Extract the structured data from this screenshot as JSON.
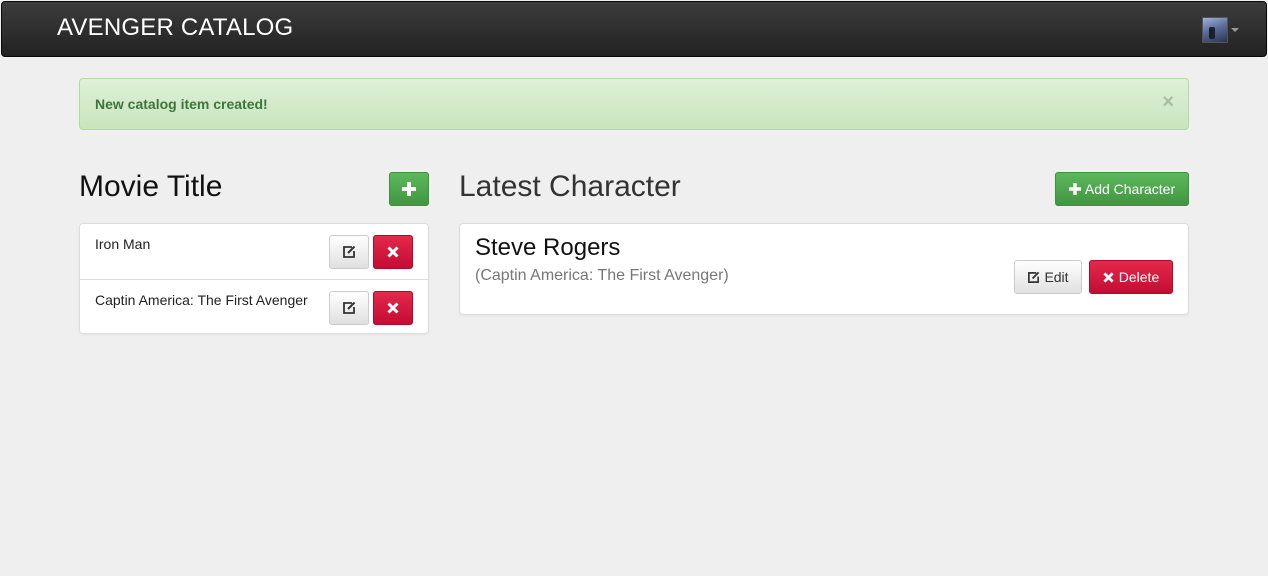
{
  "navbar": {
    "brand": "AVENGER CATALOG"
  },
  "alert": {
    "message": "New catalog item created!",
    "close": "×"
  },
  "movies": {
    "heading": "Movie Title",
    "items": [
      {
        "title": "Iron Man"
      },
      {
        "title": "Captin America: The First Avenger"
      }
    ]
  },
  "character": {
    "heading": "Latest Character",
    "add_label": "Add Character",
    "name": "Steve Rogers",
    "movie": "(Captin America: The First Avenger)",
    "edit_label": "Edit",
    "delete_label": "Delete"
  },
  "icons": {
    "add": "plus-icon",
    "edit": "edit-icon",
    "delete": "remove-icon"
  },
  "colors": {
    "success": "#5cb85c",
    "danger": "#d9163a",
    "alert_bg": "#dff0d8",
    "alert_text": "#3c763d"
  }
}
